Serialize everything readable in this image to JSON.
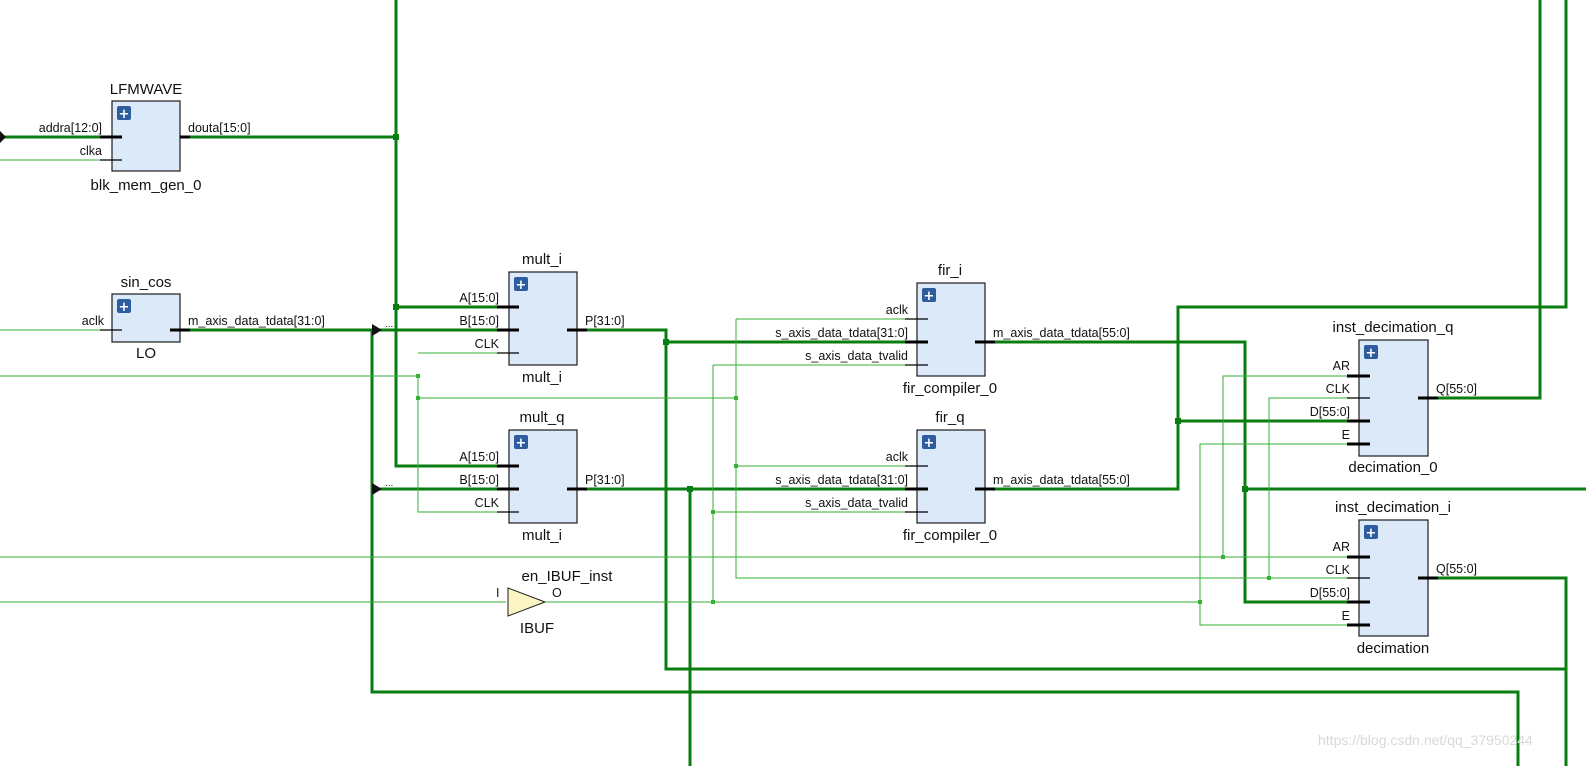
{
  "blocks": {
    "blk_mem": {
      "title": "LFMWAVE",
      "type": "blk_mem_gen_0",
      "ports_in": [
        "addra[12:0]",
        "clka"
      ],
      "ports_out": [
        "douta[15:0]"
      ]
    },
    "sin_cos": {
      "title": "sin_cos",
      "type": "LO",
      "ports_in": [
        "aclk"
      ],
      "ports_out": [
        "m_axis_data_tdata[31:0]"
      ]
    },
    "mult_i": {
      "title": "mult_i",
      "type": "mult_i",
      "ports_in": [
        "A[15:0]",
        "B[15:0]",
        "CLK"
      ],
      "ports_out": [
        "P[31:0]"
      ]
    },
    "mult_q": {
      "title": "mult_q",
      "type": "mult_i",
      "ports_in": [
        "A[15:0]",
        "B[15:0]",
        "CLK"
      ],
      "ports_out": [
        "P[31:0]"
      ]
    },
    "fir_i": {
      "title": "fir_i",
      "type": "fir_compiler_0",
      "ports_in": [
        "aclk",
        "s_axis_data_tdata[31:0]",
        "s_axis_data_tvalid"
      ],
      "ports_out": [
        "m_axis_data_tdata[55:0]"
      ]
    },
    "fir_q": {
      "title": "fir_q",
      "type": "fir_compiler_0",
      "ports_in": [
        "aclk",
        "s_axis_data_tdata[31:0]",
        "s_axis_data_tvalid"
      ],
      "ports_out": [
        "m_axis_data_tdata[55:0]"
      ]
    },
    "dec_q": {
      "title": "inst_decimation_q",
      "type": "decimation_0",
      "ports_in": [
        "AR",
        "CLK",
        "D[55:0]",
        "E"
      ],
      "ports_out": [
        "Q[55:0]"
      ]
    },
    "dec_i": {
      "title": "inst_decimation_i",
      "type": "decimation",
      "ports_in": [
        "AR",
        "CLK",
        "D[55:0]",
        "E"
      ],
      "ports_out": [
        "Q[55:0]"
      ]
    },
    "ibuf": {
      "title": "en_IBUF_inst",
      "type": "IBUF",
      "port_in": "I",
      "port_out": "O"
    }
  },
  "ellipsis": "...",
  "watermark": "https://blog.csdn.net/qq_37950244",
  "colors": {
    "wire": "#0a7d10",
    "wire_thin": "#33b233",
    "block_fill": "#dce9f8",
    "plus": "#2d5d9f",
    "buffer": "#fbf6c4"
  }
}
